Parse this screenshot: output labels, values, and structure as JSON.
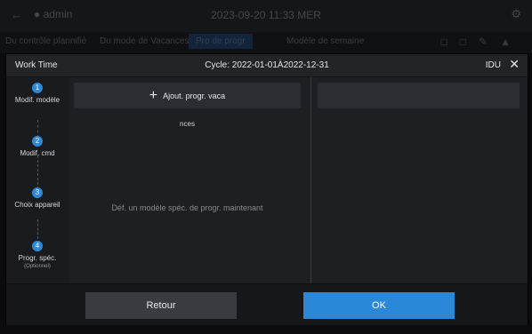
{
  "background": {
    "user": "admin",
    "datetime": "2023-09-20 11:33 MER",
    "tabs": [
      "Du contrôle plannifié",
      "Du mode de Vacances",
      "Pro de progr",
      "Modèle de semaine"
    ]
  },
  "modal": {
    "title": "Work Time",
    "cycle": "Cycle: 2022-01-01À2022-12-31",
    "idu_label": "IDU"
  },
  "steps": [
    {
      "num": "1",
      "label": "Modif. modèle",
      "sub": ""
    },
    {
      "num": "2",
      "label": "Modif. cmd",
      "sub": ""
    },
    {
      "num": "3",
      "label": "Choix appareil",
      "sub": ""
    },
    {
      "num": "4",
      "label": "Progr. spéc.",
      "sub": "(Optionnel)"
    }
  ],
  "left_panel": {
    "add_button": "Ajout. progr. vaca",
    "add_button_cont": "nces",
    "empty_message": "Déf. un modèle spéc. de progr. maintenant"
  },
  "footer": {
    "back_label": "Retour",
    "ok_label": "OK"
  },
  "colors": {
    "accent": "#2b88d8",
    "step_circle": "#2d88d6"
  }
}
